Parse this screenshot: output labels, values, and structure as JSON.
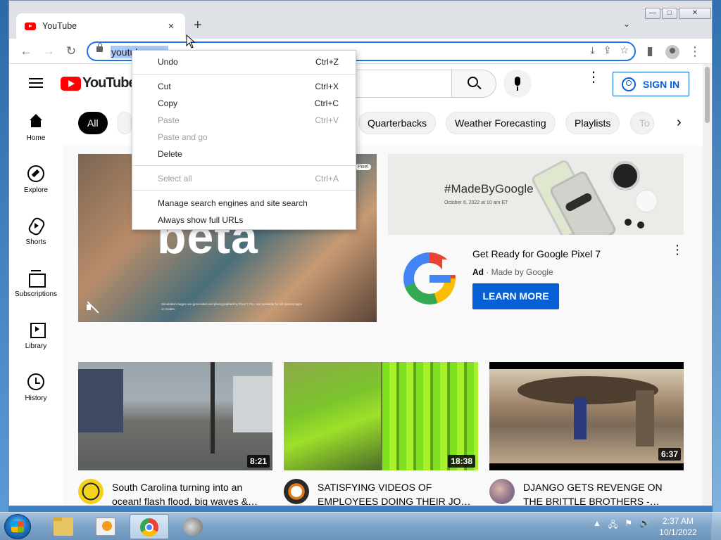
{
  "browser": {
    "tab_title": "YouTube",
    "tab_close": "×",
    "new_tab": "+",
    "tab_search": "⌄",
    "window_buttons": {
      "minimize": "—",
      "maximize": "□",
      "close": "✕"
    },
    "nav": {
      "back": "←",
      "forward": "→",
      "reload": "↻"
    },
    "url": "youtube.com",
    "omnibox_icons": [
      "install-icon",
      "share-icon",
      "star-icon"
    ],
    "side_panel": "▮",
    "menu": "⋮"
  },
  "context_menu": {
    "items": [
      {
        "label": "Undo",
        "shortcut": "Ctrl+Z",
        "enabled": true
      },
      {
        "label": "Cut",
        "shortcut": "Ctrl+X",
        "enabled": true
      },
      {
        "label": "Copy",
        "shortcut": "Ctrl+C",
        "enabled": true
      },
      {
        "label": "Paste",
        "shortcut": "Ctrl+V",
        "enabled": false
      },
      {
        "label": "Paste and go",
        "shortcut": "",
        "enabled": false
      },
      {
        "label": "Delete",
        "shortcut": "",
        "enabled": true
      },
      {
        "label": "Select all",
        "shortcut": "Ctrl+A",
        "enabled": false
      },
      {
        "label": "Manage search engines and site search",
        "shortcut": "",
        "enabled": true
      },
      {
        "label": "Always show full URLs",
        "shortcut": "",
        "enabled": true
      }
    ]
  },
  "youtube": {
    "logo_text": "YouTube",
    "sign_in": "SIGN IN",
    "sidebar": [
      {
        "label": "Home",
        "icon": "home-icon"
      },
      {
        "label": "Explore",
        "icon": "compass-icon"
      },
      {
        "label": "Shorts",
        "icon": "shorts-icon"
      },
      {
        "label": "Subscriptions",
        "icon": "subscriptions-icon"
      },
      {
        "label": "Library",
        "icon": "library-icon"
      },
      {
        "label": "History",
        "icon": "history-icon"
      }
    ],
    "chips": [
      "All",
      "Quarterbacks",
      "Weather Forecasting",
      "Playlists",
      "To"
    ],
    "chip_next": "›",
    "hero": {
      "headline": "beta",
      "badge": "Pixel",
      "fine_print": "Simulated images are generated and photographed by Pixel 7 Pro. Not available for all camera apps or modes."
    },
    "ad": {
      "banner_tag": "#MadeByGoogle",
      "banner_date": "October 6, 2022 at 10 am ET",
      "title": "Get Ready for Google Pixel 7",
      "label": "Ad",
      "advertiser": "Made by Google",
      "cta": "LEARN MORE",
      "menu": "⋮"
    },
    "videos": [
      {
        "title": "South Carolina turning into an ocean! flash flood, big waves &…",
        "duration": "8:21"
      },
      {
        "title": "SATISFYING VIDEOS OF EMPLOYEES DOING THEIR JO…",
        "duration": "18:38"
      },
      {
        "title": "DJANGO GETS REVENGE ON THE BRITTLE BROTHERS -…",
        "duration": "6:37"
      }
    ]
  },
  "taskbar": {
    "time": "2:37 AM",
    "date": "10/1/2022",
    "tray_icons": [
      "show-hidden-icon",
      "network-icon",
      "action-center-icon",
      "volume-icon"
    ],
    "tray_glyphs": {
      "arrow": "▲",
      "network": "🖧",
      "flag": "⚑",
      "volume": "🔊"
    }
  },
  "colors": {
    "youtube_red": "#ff0000",
    "link_blue": "#065fd4",
    "omnibox_focus": "#1a73e8"
  }
}
